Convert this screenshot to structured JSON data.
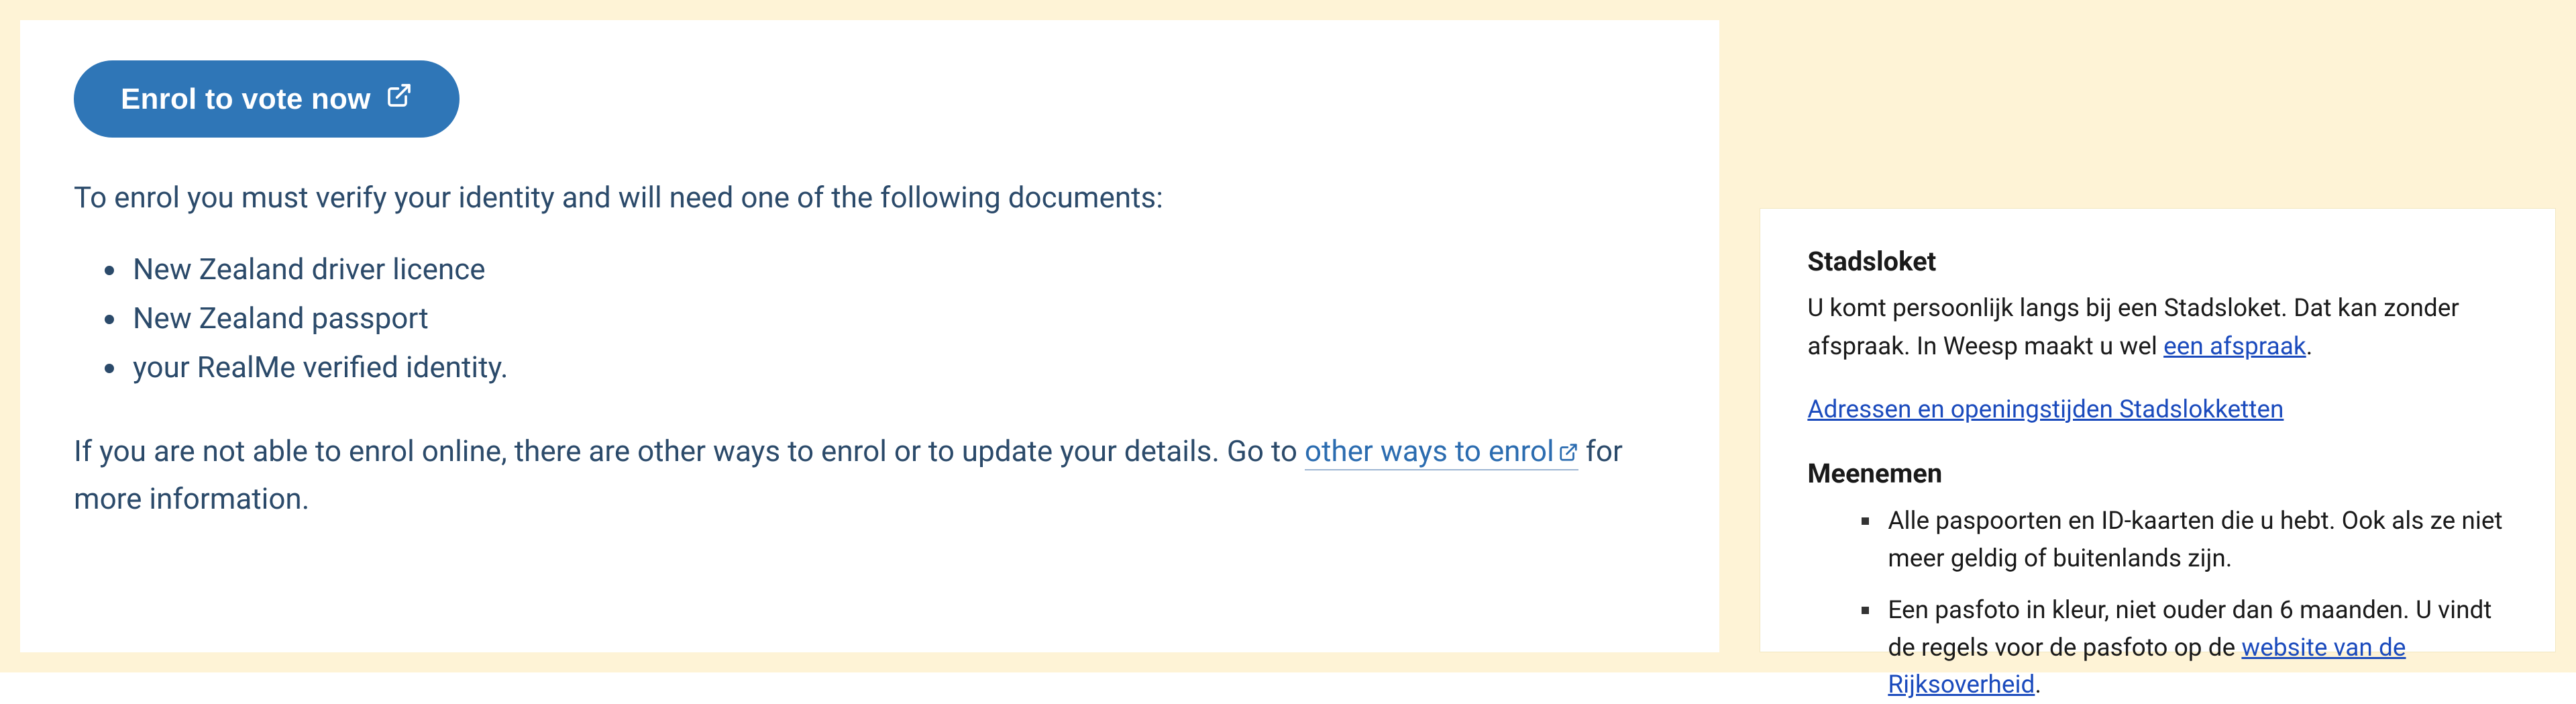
{
  "left": {
    "cta_label": "Enrol to vote now",
    "intro": "To enrol you must verify your identity and will need one of the following documents:",
    "docs": [
      "New Zealand driver licence",
      "New Zealand passport",
      "your RealMe verified identity."
    ],
    "tail_pre": "If you are not able to enrol online, there are other ways to enrol or to update your details. Go to ",
    "tail_link": "other ways to enrol",
    "tail_post": " for more information."
  },
  "right": {
    "heading1": "Stadsloket",
    "para1_pre": "U komt persoonlijk langs bij een Stadsloket. Dat kan zonder afspraak. In Weesp maakt u wel ",
    "para1_link": "een afspraak",
    "para1_post": ".",
    "locations_link": "Adressen en openingstijden Stadslokketten",
    "heading2": "Meenemen",
    "items": [
      {
        "pre": "Alle paspoorten en ID-kaarten die u hebt. Ook als ze niet meer geldig of buitenlands zijn.",
        "link": "",
        "post": ""
      },
      {
        "pre": "Een pasfoto in kleur, niet ouder dan 6 maanden. U vindt de regels voor de pasfoto op de ",
        "link": "website van de Rijksoverheid",
        "post": "."
      }
    ]
  }
}
